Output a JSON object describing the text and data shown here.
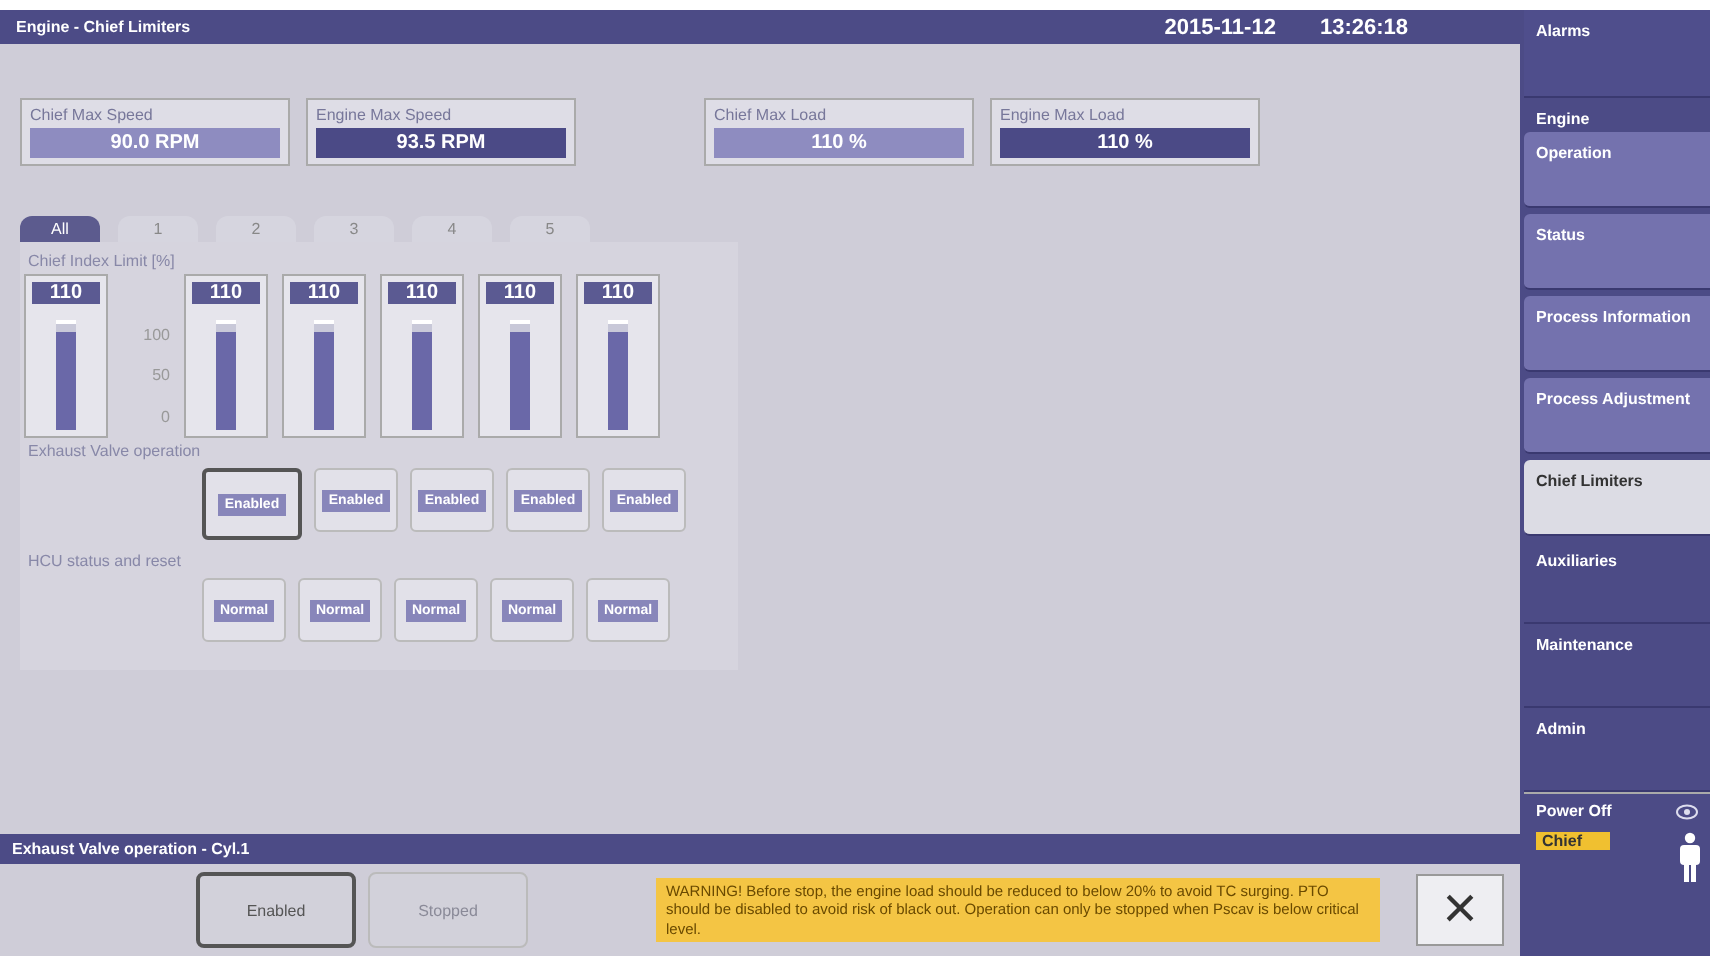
{
  "header": {
    "title": "Engine - Chief Limiters",
    "date": "2015-11-12",
    "time": "13:26:18"
  },
  "limits": [
    {
      "label": "Chief Max Speed",
      "value": "90.0 RPM",
      "kind": "chief"
    },
    {
      "label": "Engine Max Speed",
      "value": "93.5 RPM",
      "kind": "engine"
    },
    {
      "label": "Chief Max Load",
      "value": "110 %",
      "kind": "chief"
    },
    {
      "label": "Engine Max Load",
      "value": "110 %",
      "kind": "engine"
    }
  ],
  "tabs": [
    {
      "label": "All",
      "selected": true
    },
    {
      "label": "1",
      "selected": false
    },
    {
      "label": "2",
      "selected": false
    },
    {
      "label": "3",
      "selected": false
    },
    {
      "label": "4",
      "selected": false
    },
    {
      "label": "5",
      "selected": false
    }
  ],
  "index_limit": {
    "title": "Chief Index Limit [%]",
    "scale": [
      "100",
      "50",
      "0"
    ],
    "gauges": [
      {
        "value": "110",
        "level": 0.92
      },
      {
        "value": "110",
        "level": 0.92
      },
      {
        "value": "110",
        "level": 0.92
      },
      {
        "value": "110",
        "level": 0.92
      },
      {
        "value": "110",
        "level": 0.92
      },
      {
        "value": "110",
        "level": 0.92
      }
    ]
  },
  "exhaust_valve": {
    "title": "Exhaust Valve operation",
    "buttons": [
      {
        "label": "Enabled",
        "selected": true
      },
      {
        "label": "Enabled",
        "selected": false
      },
      {
        "label": "Enabled",
        "selected": false
      },
      {
        "label": "Enabled",
        "selected": false
      },
      {
        "label": "Enabled",
        "selected": false
      }
    ]
  },
  "hcu": {
    "title": "HCU status and reset",
    "buttons": [
      {
        "label": "Normal"
      },
      {
        "label": "Normal"
      },
      {
        "label": "Normal"
      },
      {
        "label": "Normal"
      },
      {
        "label": "Normal"
      }
    ]
  },
  "bottom": {
    "title": "Exhaust Valve operation - Cyl.1",
    "buttons": [
      {
        "label": "Enabled",
        "selected": true,
        "disabled": false
      },
      {
        "label": "Stopped",
        "selected": false,
        "disabled": true
      }
    ],
    "warning": "WARNING! Before stop, the engine load should be reduced to below 20% to avoid TC surging. PTO should be disabled to avoid risk of black out. Operation can only be stopped when Pscav is below critical level.",
    "close": "×"
  },
  "sidebar": {
    "items": [
      {
        "label": "Alarms",
        "kind": "main",
        "selected": false
      },
      {
        "label": "Engine",
        "kind": "group"
      },
      {
        "label": "Operation",
        "kind": "sub",
        "selected": false
      },
      {
        "label": "Status",
        "kind": "sub",
        "selected": false
      },
      {
        "label": "Process Information",
        "kind": "sub",
        "selected": false
      },
      {
        "label": "Process Adjustment",
        "kind": "sub",
        "selected": false
      },
      {
        "label": "Chief Limiters",
        "kind": "sub",
        "selected": true
      },
      {
        "label": "Auxiliaries",
        "kind": "main",
        "selected": false
      },
      {
        "label": "Maintenance",
        "kind": "main",
        "selected": false
      },
      {
        "label": "Admin",
        "kind": "main",
        "selected": false
      }
    ],
    "power": "Power Off",
    "user": "Chief"
  }
}
